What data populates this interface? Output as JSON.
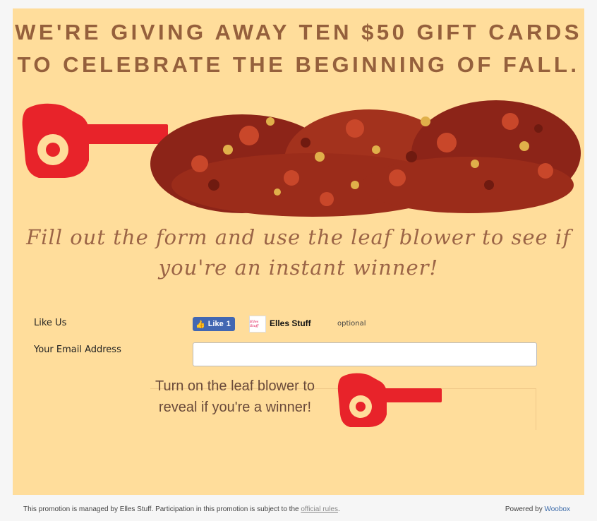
{
  "headline": {
    "line1": "WE'RE GIVING AWAY TEN $50 GIFT CARDS",
    "line2": "TO CELEBRATE THE BEGINNING OF FALL."
  },
  "subtitle": {
    "line1": "Fill out the form and use the leaf blower to see if",
    "line2": "you're an instant winner!"
  },
  "form": {
    "like_label": "Like Us",
    "fb_like_text": "Like",
    "fb_like_count": "1",
    "page_name": "Elles Stuff",
    "page_logo_text": "Elles Stuff",
    "optional_text": "optional",
    "email_label": "Your Email Address",
    "email_value": ""
  },
  "reveal": {
    "line1": "Turn on the leaf blower to",
    "line2": "reveal if you're a winner!"
  },
  "footer": {
    "text_before": "This promotion is managed by Elles Stuff. Participation in this promotion is subject to the ",
    "rules_link": "official rules",
    "text_after": ".",
    "powered_by": "Powered by ",
    "brand_link": "Woobox"
  },
  "colors": {
    "panel": "#ffdd9b",
    "headline": "#95603c",
    "blower": "#e8232a"
  },
  "icons": {
    "blower": "leaf-blower-icon",
    "like": "thumbs-up-icon"
  }
}
